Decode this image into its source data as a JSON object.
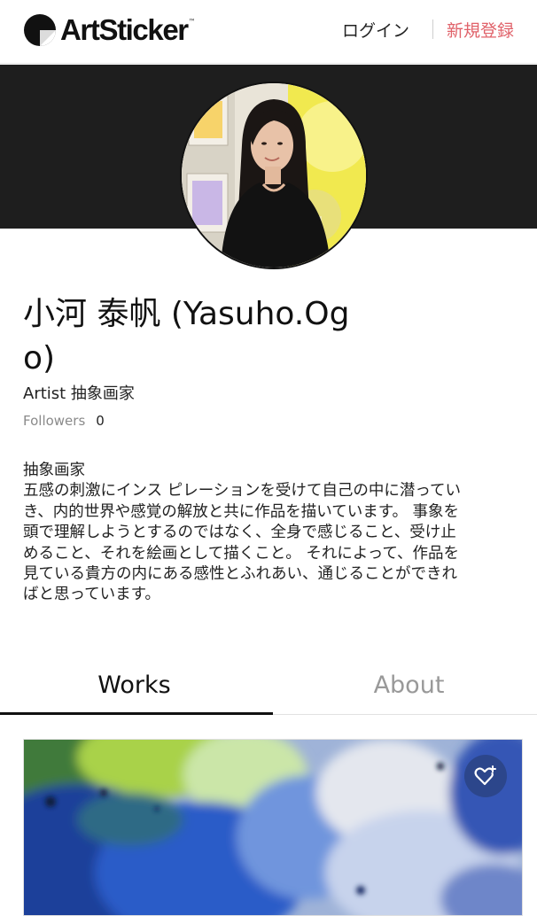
{
  "header": {
    "logo_text": "ArtSticker",
    "logo_tm": "™",
    "login_label": "ログイン",
    "register_label": "新規登録",
    "register_color": "#e0626a"
  },
  "profile": {
    "name": "小河 泰帆 (Yasuho.Ogo)",
    "role": "Artist 抽象画家",
    "followers_label": "Followers",
    "followers_count": "0",
    "bio": "抽象画家\n五感の刺激にインス ピレーションを受けて自己の中に潜ってい\nき、内的世界や感覚の解放と共に作品を描いています。 事象を\n頭で理解しようとするのではなく、全身で感じること、受け止\nめること、それを絵画として描くこと。 それによって、作品を\n見ている貴方の内にある感性とふれあい、通じることができれ\nばと思っています。"
  },
  "tabs": [
    {
      "label": "Works",
      "active": true
    },
    {
      "label": "About",
      "active": false
    }
  ],
  "icons": {
    "favorite": "heart-plus-icon"
  }
}
